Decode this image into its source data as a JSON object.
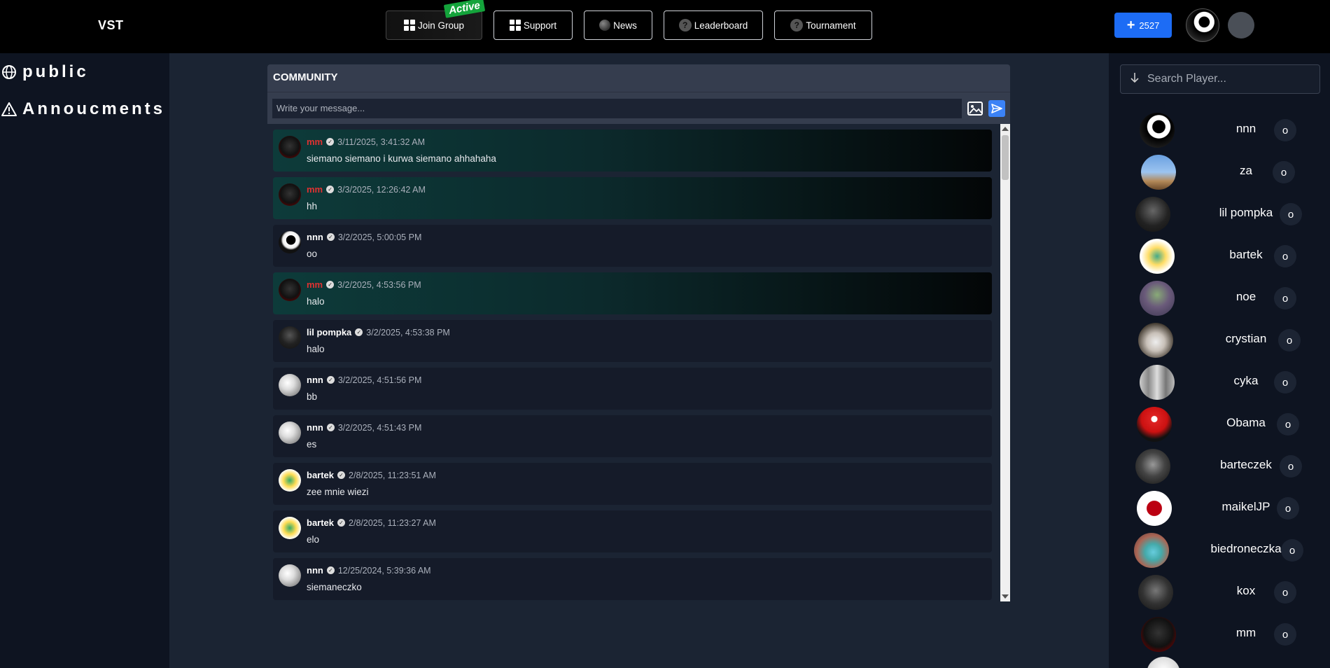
{
  "header": {
    "logo": "VST",
    "nav": {
      "join_group": "Join Group",
      "active_tag": "Active",
      "support": "Support",
      "news": "News",
      "leaderboard": "Leaderboard",
      "tournament": "Tournament"
    },
    "coins": "2527",
    "accent": "#1d6cf5"
  },
  "sidebar": {
    "channels": [
      {
        "icon": "globe-icon",
        "label": "public"
      },
      {
        "icon": "warning-icon",
        "label": "Annoucments"
      }
    ]
  },
  "chat": {
    "title": "COMMUNITY",
    "placeholder": "Write your message...",
    "messages": [
      {
        "user": "mm",
        "time": "3/11/2025, 3:41:32 AM",
        "text": "siemano siemano i kurwa siemano ahhahaha",
        "highlight": true
      },
      {
        "user": "mm",
        "time": "3/3/2025, 12:26:42 AM",
        "text": "hh",
        "highlight": true
      },
      {
        "user": "nnn",
        "time": "3/2/2025, 5:00:05 PM",
        "text": "oo",
        "highlight": false
      },
      {
        "user": "mm",
        "time": "3/2/2025, 4:53:56 PM",
        "text": "halo",
        "highlight": true
      },
      {
        "user": "lil pompka",
        "time": "3/2/2025, 4:53:38 PM",
        "text": "halo",
        "highlight": false
      },
      {
        "user": "nnn",
        "time": "3/2/2025, 4:51:56 PM",
        "text": "bb",
        "highlight": false
      },
      {
        "user": "nnn",
        "time": "3/2/2025, 4:51:43 PM",
        "text": "es",
        "highlight": false
      },
      {
        "user": "bartek",
        "time": "2/8/2025, 11:23:51 AM",
        "text": "zee mnie wiezi",
        "highlight": false
      },
      {
        "user": "bartek",
        "time": "2/8/2025, 11:23:27 AM",
        "text": "elo",
        "highlight": false
      },
      {
        "user": "nnn",
        "time": "12/25/2024, 5:39:36 AM",
        "text": "siemaneczko",
        "highlight": false
      }
    ]
  },
  "players": {
    "search_placeholder": "Search Player...",
    "list": [
      {
        "name": "nnn",
        "action": "o"
      },
      {
        "name": "za",
        "action": "o"
      },
      {
        "name": "lil pompka",
        "action": "o"
      },
      {
        "name": "bartek",
        "action": "o"
      },
      {
        "name": "noe",
        "action": "o"
      },
      {
        "name": "crystian",
        "action": "o"
      },
      {
        "name": "cyka",
        "action": "o"
      },
      {
        "name": "Obama",
        "action": "o"
      },
      {
        "name": "barteczek",
        "action": "o"
      },
      {
        "name": "maikelJP",
        "action": "o"
      },
      {
        "name": "biedroneczka",
        "action": "o"
      },
      {
        "name": "kox",
        "action": "o"
      },
      {
        "name": "mm",
        "action": "o"
      }
    ]
  }
}
